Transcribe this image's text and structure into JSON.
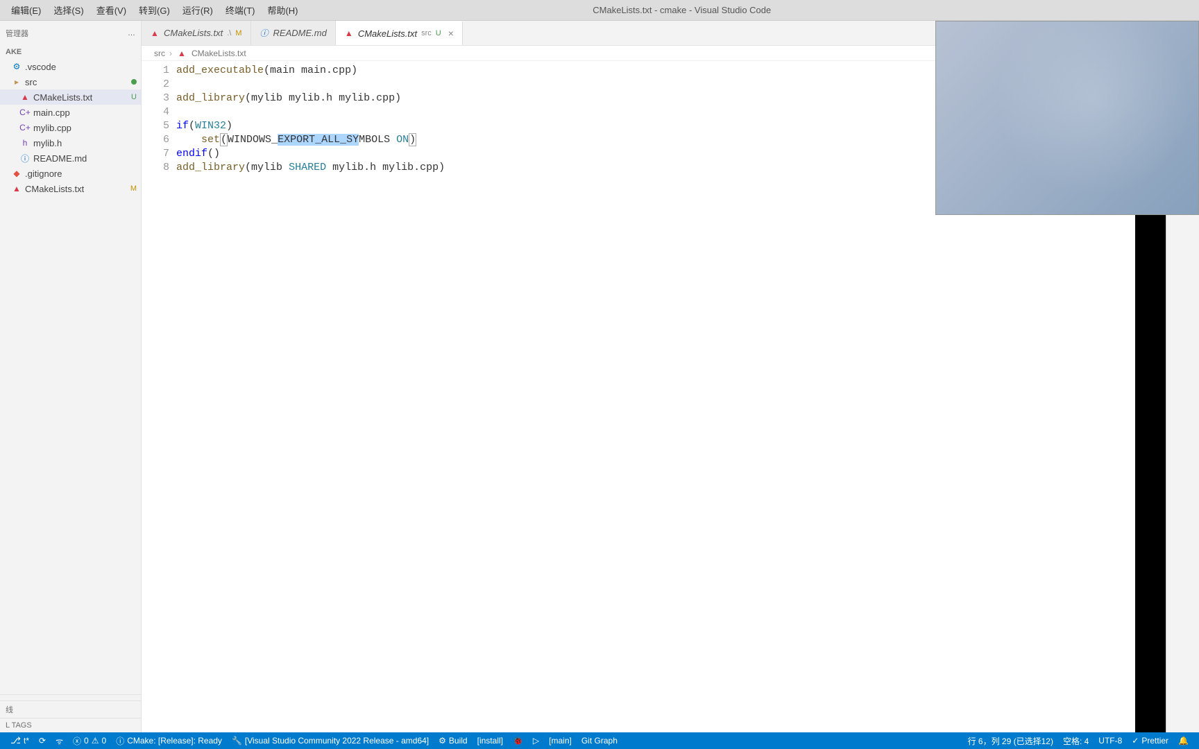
{
  "menubar": {
    "edit": "编辑(E)",
    "select": "选择(S)",
    "view": "查看(V)",
    "go": "转到(G)",
    "run": "运行(R)",
    "terminal": "终端(T)",
    "help": "帮助(H)"
  },
  "title": "CMakeLists.txt - cmake - Visual Studio Code",
  "sidebar": {
    "header": "管理器",
    "header_action": "…",
    "section": "AKE",
    "items": [
      {
        "label": ".vscode",
        "icon": "vs",
        "indent": 1,
        "status": ""
      },
      {
        "label": "src",
        "icon": "folder",
        "indent": 1,
        "status": "dot"
      },
      {
        "label": "CMakeLists.txt",
        "icon": "cmake",
        "indent": 2,
        "status": "U",
        "selected": true
      },
      {
        "label": "main.cpp",
        "icon": "cpp",
        "indent": 2,
        "status": ""
      },
      {
        "label": "mylib.cpp",
        "icon": "cpp",
        "indent": 2,
        "status": ""
      },
      {
        "label": "mylib.h",
        "icon": "h",
        "indent": 2,
        "status": ""
      },
      {
        "label": "README.md",
        "icon": "md",
        "indent": 2,
        "status": ""
      },
      {
        "label": ".gitignore",
        "icon": "git",
        "indent": 1,
        "status": ""
      },
      {
        "label": "CMakeLists.txt",
        "icon": "cmake",
        "indent": 1,
        "status": "M"
      }
    ],
    "bottom": [
      "",
      "线",
      "L TAGS"
    ]
  },
  "tabs": [
    {
      "icon": "cmake",
      "label": "CMakeLists.txt",
      "suffix": ".\\",
      "status": "M",
      "dirty": false,
      "active": false
    },
    {
      "icon": "md",
      "label": "README.md",
      "suffix": "",
      "status": "",
      "dirty": false,
      "active": false
    },
    {
      "icon": "cmake",
      "label": "CMakeLists.txt",
      "suffix": "src",
      "status": "U",
      "dirty": false,
      "active": true
    }
  ],
  "breadcrumb": {
    "p1": "src",
    "p2": "CMakeLists.txt"
  },
  "code": {
    "lines": [
      {
        "n": "1",
        "html": "<span class='tok-fn'>add_executable</span><span class='tok-paren'>(</span>main main.cpp<span class='tok-paren'>)</span>"
      },
      {
        "n": "2",
        "html": ""
      },
      {
        "n": "3",
        "html": "<span class='tok-fn'>add_library</span><span class='tok-paren'>(</span>mylib mylib.h mylib.cpp<span class='tok-paren'>)</span>"
      },
      {
        "n": "4",
        "html": ""
      },
      {
        "n": "5",
        "html": "<span class='tok-kw'>if</span><span class='tok-paren'>(</span><span class='tok-var'>WIN32</span><span class='tok-paren'>)</span>"
      },
      {
        "n": "6",
        "html": "    <span class='tok-fn'>set</span><span class='tok-paren bracket-match'>(</span>WINDOWS_<span class='sel'>EXPORT_ALL_SY</span>MBOLS <span class='tok-var'>ON</span><span class='tok-paren bracket-match'>)</span>"
      },
      {
        "n": "7",
        "html": "<span class='tok-kw'>endif</span><span class='tok-paren'>()</span>"
      },
      {
        "n": "8",
        "html": "<span class='tok-fn'>add_library</span><span class='tok-paren'>(</span>mylib <span class='tok-var'>SHARED</span> mylib.h mylib.cpp<span class='tok-paren'>)</span>"
      }
    ]
  },
  "statusbar": {
    "branch": "t*",
    "sync": "⟳",
    "errors": "0",
    "warnings": "0",
    "cmake": "CMake: [Release]: Ready",
    "kit": "[Visual Studio Community 2022 Release - amd64]",
    "build": "Build",
    "install": "[install]",
    "debug": "⚙",
    "run": "▷",
    "target": "[main]",
    "gitgraph": "Git Graph",
    "cursor": "行 6，列 29 (已选择12)",
    "spaces": "空格: 4",
    "encoding": "UTF-8",
    "prettier": "Prettier",
    "bell": "🔔"
  }
}
